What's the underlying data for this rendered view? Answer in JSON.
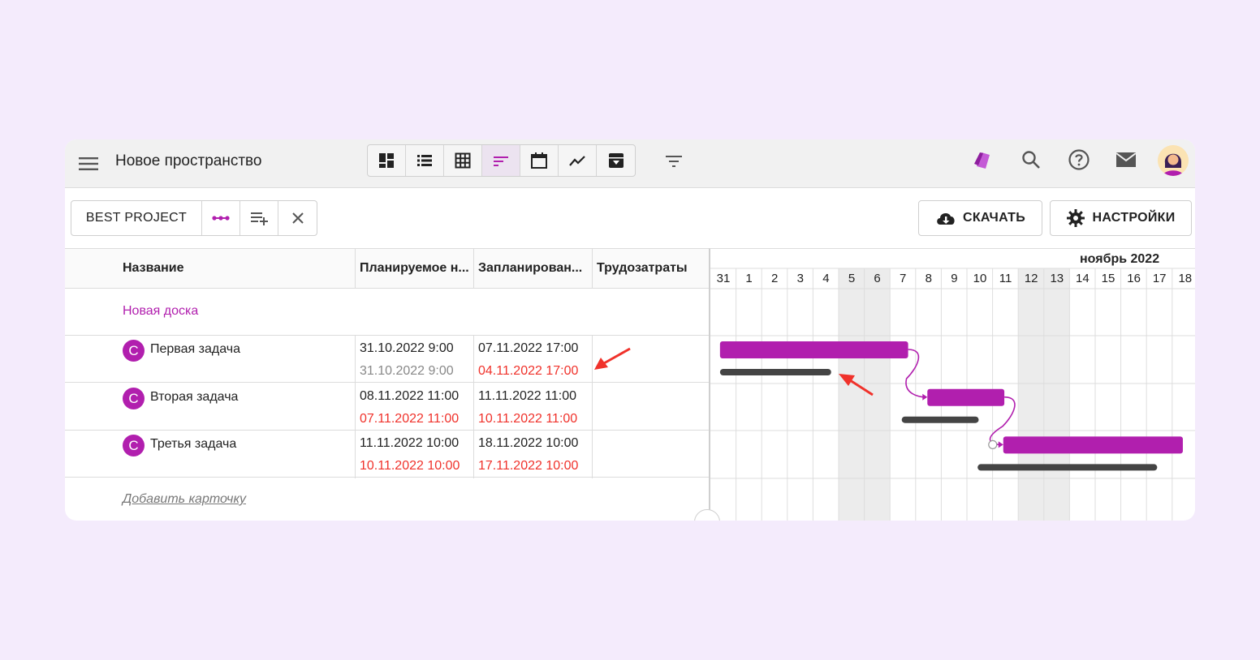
{
  "topbar": {
    "title": "Новое пространство",
    "views": [
      {
        "icon": "dashboard-icon",
        "active": false
      },
      {
        "icon": "list-icon",
        "active": false
      },
      {
        "icon": "table-grid-icon",
        "active": false
      },
      {
        "icon": "gantt-icon",
        "active": true
      },
      {
        "icon": "calendar-icon",
        "active": false
      },
      {
        "icon": "chart-line-icon",
        "active": false
      },
      {
        "icon": "archive-icon",
        "active": false
      }
    ],
    "right_icons": [
      "tags-icon",
      "search-icon",
      "help-icon",
      "mail-icon",
      "avatar"
    ]
  },
  "toolbar": {
    "project": "BEST PROJECT",
    "download": "СКАЧАТЬ",
    "settings": "НАСТРОЙКИ"
  },
  "table": {
    "headers": [
      "Название",
      "Планируемое н...",
      "Запланирован...",
      "Трудозатраты"
    ],
    "group": "Новая доска",
    "tasks": [
      {
        "avatar": "С",
        "name": "Первая задача",
        "plan_start": "31.10.2022 9:00",
        "plan_end": "07.11.2022 17:00",
        "base_start": "31.10.2022 9:00",
        "base_end": "04.11.2022 17:00",
        "base_start_color": "grey",
        "base_end_color": "red"
      },
      {
        "avatar": "С",
        "name": "Вторая задача",
        "plan_start": "08.11.2022 11:00",
        "plan_end": "11.11.2022 11:00",
        "base_start": "07.11.2022 11:00",
        "base_end": "10.11.2022 11:00",
        "base_start_color": "red",
        "base_end_color": "red"
      },
      {
        "avatar": "С",
        "name": "Третья задача",
        "plan_start": "11.11.2022 10:00",
        "plan_end": "18.11.2022 10:00",
        "base_start": "10.11.2022 10:00",
        "base_end": "17.11.2022 10:00",
        "base_start_color": "red",
        "base_end_color": "red"
      }
    ],
    "add_card": "Добавить карточку"
  },
  "gantt": {
    "month": "ноябрь 2022",
    "days": [
      "31",
      "1",
      "2",
      "3",
      "4",
      "5",
      "6",
      "7",
      "8",
      "9",
      "10",
      "11",
      "12",
      "13",
      "14",
      "15",
      "16",
      "17",
      "18"
    ],
    "weekend_days": [
      "5",
      "6",
      "12",
      "13"
    ],
    "colors": {
      "plan_bar": "#b11fae",
      "baseline_bar": "#444444",
      "arrow": "#f0322b"
    }
  }
}
